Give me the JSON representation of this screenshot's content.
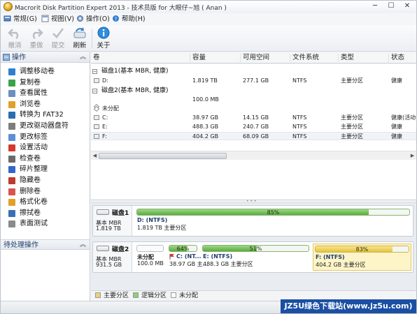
{
  "window": {
    "title": "Macrorit Disk Partition Expert 2013 - 技术员版 for 大眼仔~旭 ( Anan )",
    "min": "─",
    "max": "☐",
    "close": "✕"
  },
  "menu": {
    "general": "常规(G)",
    "view": "视图(V)",
    "action": "操作(O)",
    "help": "帮助(H)"
  },
  "toolbar": {
    "undo": "撤消",
    "redo": "重做",
    "commit": "提交",
    "refresh": "刷新",
    "about": "关于"
  },
  "left": {
    "ops_title": "操作",
    "ops": [
      {
        "label": "调整移动卷",
        "icon": "resize-move-icon",
        "color": "#2f7fd0"
      },
      {
        "label": "复制卷",
        "icon": "copy-volume-icon",
        "color": "#3aa34a"
      },
      {
        "label": "查看属性",
        "icon": "properties-icon",
        "color": "#6b8fbf"
      },
      {
        "label": "浏览卷",
        "icon": "explore-icon",
        "color": "#e0a12a"
      },
      {
        "label": "转换为 FAT32",
        "icon": "convert-icon",
        "color": "#2b6cb0"
      },
      {
        "label": "更改驱动器盘符",
        "icon": "drive-letter-icon",
        "color": "#7d7d7d"
      },
      {
        "label": "更改标签",
        "icon": "label-icon",
        "color": "#5c8fd6"
      },
      {
        "label": "设置活动",
        "icon": "set-active-icon",
        "color": "#d33a2c"
      },
      {
        "label": "检查卷",
        "icon": "check-volume-icon",
        "color": "#6a6a6a"
      },
      {
        "label": "碎片整理",
        "icon": "defrag-icon",
        "color": "#3366cc"
      },
      {
        "label": "隐藏卷",
        "icon": "hide-volume-icon",
        "color": "#c0392b"
      },
      {
        "label": "删除卷",
        "icon": "delete-volume-icon",
        "color": "#d9534f"
      },
      {
        "label": "格式化卷",
        "icon": "format-volume-icon",
        "color": "#e0a12a"
      },
      {
        "label": "擦拭卷",
        "icon": "wipe-volume-icon",
        "color": "#3a6fb5"
      },
      {
        "label": "表面测试",
        "icon": "surface-test-icon",
        "color": "#8a8a8a"
      }
    ],
    "pending_title": "待处理操作",
    "chev_up": "︽"
  },
  "columns": {
    "volume": "卷",
    "capacity": "容量",
    "free": "可用空间",
    "fs": "文件系统",
    "type": "类型",
    "status": "状态"
  },
  "disks": [
    {
      "group": "磁盘1(基本 MBR, 健康)",
      "rows": [
        {
          "name": "D:",
          "cap": "1.819 TB",
          "free": "277.1 GB",
          "fs": "NTFS",
          "type": "主要分区",
          "status": "健康"
        }
      ]
    },
    {
      "group": "磁盘2(基本 MBR, 健康)",
      "rows": [
        {
          "name": "未分配",
          "cap": "100.0 MB",
          "free": "",
          "fs": "",
          "type": "",
          "status": ""
        },
        {
          "name": "C:",
          "cap": "38.97 GB",
          "free": "14.15 GB",
          "fs": "NTFS",
          "type": "主要分区",
          "status": "健康(活动"
        },
        {
          "name": "E:",
          "cap": "488.3 GB",
          "free": "240.7 GB",
          "fs": "NTFS",
          "type": "主要分区",
          "status": "健康"
        },
        {
          "name": "F:",
          "cap": "404.2 GB",
          "free": "68.09 GB",
          "fs": "NTFS",
          "type": "主要分区",
          "status": "健康"
        }
      ]
    }
  ],
  "diskmap": {
    "disk1": {
      "name": "磁盘1",
      "type": "基本 MBR",
      "size": "1.819 TB",
      "parts": [
        {
          "name": "D: (NTFS)",
          "desc": "1.819 TB 主要分区",
          "pct_label": "85%",
          "fill": 0.85
        }
      ]
    },
    "disk2": {
      "name": "磁盘2",
      "type": "基本 MBR",
      "size": "931.5 GB",
      "parts": [
        {
          "name": "未分配",
          "desc": "100.0 MB",
          "pct_label": "",
          "fill": 0
        },
        {
          "name": "C: (NT...",
          "desc": "38.97 GB 主...",
          "pct_label": "64%",
          "fill": 0.64
        },
        {
          "name": "E: (NTFS)",
          "desc": "488.3 GB 主要分区",
          "pct_label": "51%",
          "fill": 0.51
        },
        {
          "name": "F: (NTFS)",
          "desc": "404.2 GB 主要分区",
          "pct_label": "83%",
          "fill": 0.83
        }
      ]
    }
  },
  "legend": {
    "primary": "主要分区",
    "logical": "逻辑分区",
    "unalloc": "未分配",
    "primary_color": "#e9d27a",
    "logical_color": "#8fcf76",
    "unalloc_color": "#ffffff"
  },
  "watermark": "JZ5U绿色下载站(www.jz5u.com)"
}
